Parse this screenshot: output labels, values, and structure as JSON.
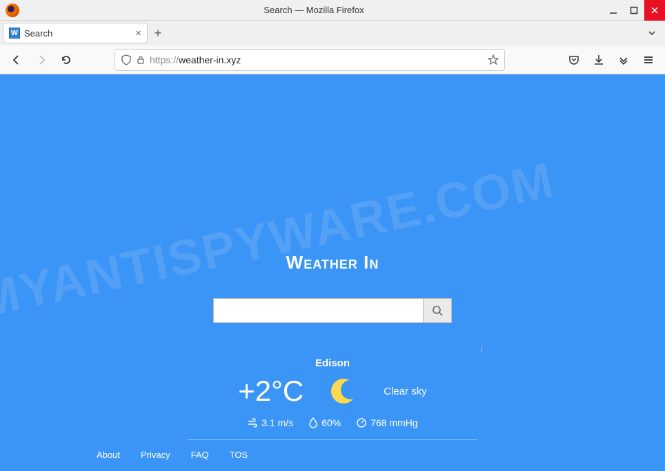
{
  "window": {
    "title": "Search — Mozilla Firefox"
  },
  "tab": {
    "favicon_letter": "W",
    "title": "Search"
  },
  "url": {
    "protocol": "https://",
    "domain": "weather-in.xyz"
  },
  "page": {
    "brand": "Weather In",
    "search_placeholder": "",
    "watermark": "MYANTISPYWARE.COM"
  },
  "weather": {
    "city": "Edison",
    "temperature": "+2°C",
    "description": "Clear sky",
    "wind": "3.1 m/s",
    "humidity": "60%",
    "pressure": "768 mmHg"
  },
  "footer": {
    "about": "About",
    "privacy": "Privacy",
    "faq": "FAQ",
    "tos": "TOS"
  }
}
